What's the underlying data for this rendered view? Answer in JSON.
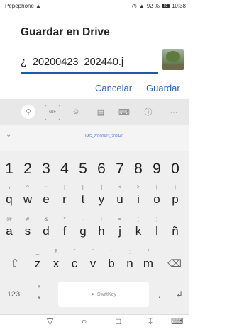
{
  "status": {
    "carrier": "Pepephone",
    "signal": "‰¸¸¸",
    "battery_pct": "92 %",
    "battery_icon_text": "92",
    "time": "10:38"
  },
  "dialog": {
    "title": "Guardar en Drive",
    "filename_value": "¿_20200423_202440.j",
    "cancel_label": "Cancelar",
    "save_label": "Guardar"
  },
  "keyboard": {
    "suggestion": "IMG_20200423_202440",
    "number_row": [
      {
        "main": "1"
      },
      {
        "main": "2"
      },
      {
        "main": "3"
      },
      {
        "main": "4"
      },
      {
        "main": "5"
      },
      {
        "main": "6"
      },
      {
        "main": "7"
      },
      {
        "main": "8"
      },
      {
        "main": "9"
      },
      {
        "main": "0"
      }
    ],
    "row1": [
      {
        "sub": "\\",
        "main": "q"
      },
      {
        "sub": "^",
        "main": "w"
      },
      {
        "sub": "~",
        "main": "e"
      },
      {
        "sub": "|",
        "main": "r"
      },
      {
        "sub": "[",
        "main": "t"
      },
      {
        "sub": "]",
        "main": "y"
      },
      {
        "sub": "<",
        "main": "u"
      },
      {
        "sub": ">",
        "main": "i"
      },
      {
        "sub": "{",
        "main": "o"
      },
      {
        "sub": "}",
        "main": "p"
      }
    ],
    "row2": [
      {
        "sub": "@",
        "main": "a"
      },
      {
        "sub": "#",
        "main": "s"
      },
      {
        "sub": "&",
        "main": "d"
      },
      {
        "sub": "*",
        "main": "f"
      },
      {
        "sub": "-",
        "main": "g"
      },
      {
        "sub": "+",
        "main": "h"
      },
      {
        "sub": "=",
        "main": "j"
      },
      {
        "sub": "(",
        "main": "k"
      },
      {
        "sub": ")",
        "main": "l"
      },
      {
        "sub": "",
        "main": "ñ"
      }
    ],
    "row3": [
      {
        "sub": "_",
        "main": "z"
      },
      {
        "sub": "€",
        "main": "x"
      },
      {
        "sub": "\"",
        "main": "c"
      },
      {
        "sub": "'",
        "main": "v"
      },
      {
        "sub": ":",
        "main": "b"
      },
      {
        "sub": ";",
        "main": "n"
      },
      {
        "sub": "/",
        "main": "m"
      }
    ],
    "numbers_key": "123",
    "comma": ",",
    "period": ".",
    "space_label": "SwiftKey"
  }
}
